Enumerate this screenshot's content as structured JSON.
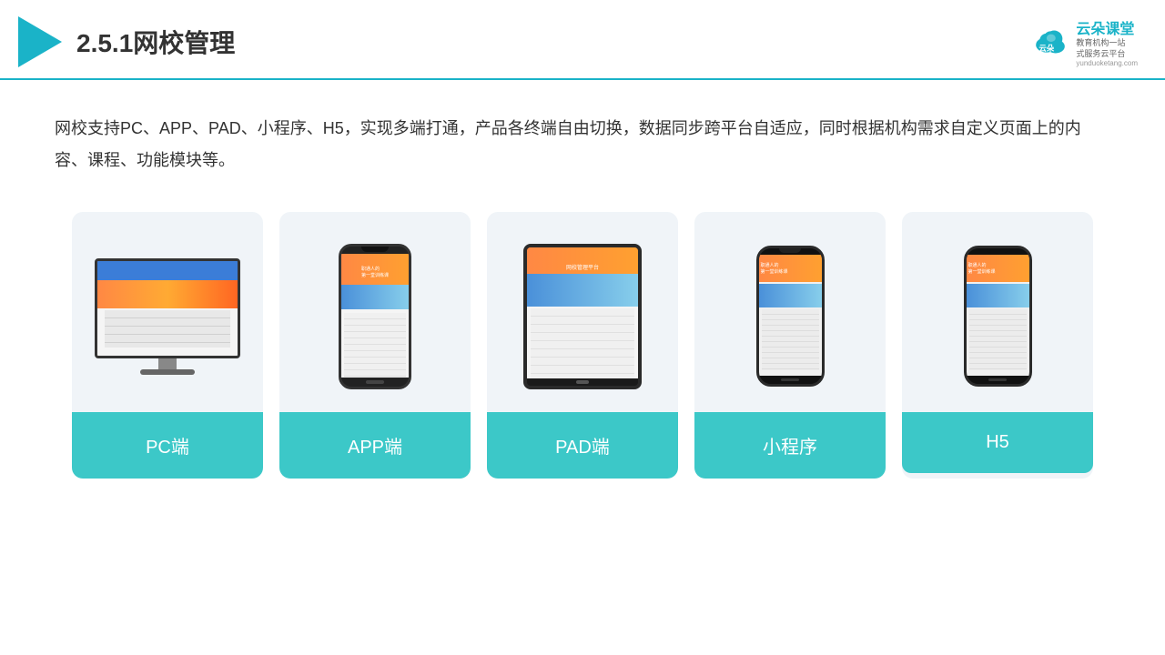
{
  "header": {
    "title": "2.5.1网校管理",
    "brand": {
      "name": "云朵课堂",
      "sub1": "教育机构一站",
      "sub2": "式服务云平台",
      "url": "yunduoketang.com"
    }
  },
  "description": {
    "text": "网校支持PC、APP、PAD、小程序、H5，实现多端打通，产品各终端自由切换，数据同步跨平台自适应，同时根据机构需求自定义页面上的内容、课程、功能模块等。"
  },
  "cards": [
    {
      "id": "pc",
      "label": "PC端",
      "type": "pc"
    },
    {
      "id": "app",
      "label": "APP端",
      "type": "phone"
    },
    {
      "id": "pad",
      "label": "PAD端",
      "type": "tablet"
    },
    {
      "id": "miniprogram",
      "label": "小程序",
      "type": "phone2"
    },
    {
      "id": "h5",
      "label": "H5",
      "type": "phone3"
    }
  ],
  "colors": {
    "accent": "#3cc8c8",
    "headerLine": "#1ab3c8",
    "titleColor": "#333333",
    "textColor": "#333333"
  }
}
